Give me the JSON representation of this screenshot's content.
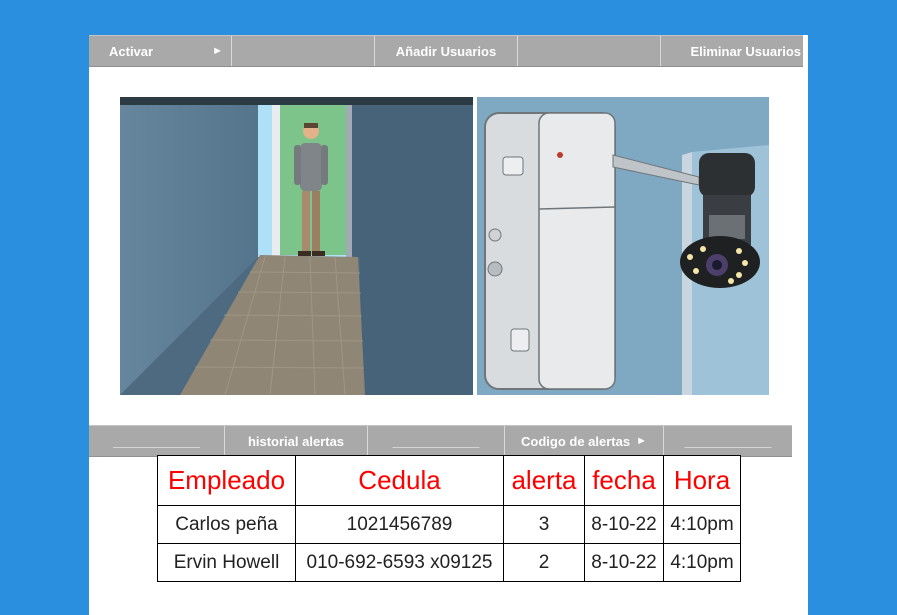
{
  "top_nav": {
    "items": [
      {
        "label": "Activar",
        "arrow": "►"
      },
      {
        "label": ""
      },
      {
        "label": "Añadir Usuarios"
      },
      {
        "label": ""
      },
      {
        "label": "Eliminar Usuarios"
      }
    ]
  },
  "bottom_nav": {
    "items": [
      {
        "label": "____________"
      },
      {
        "label": "historial alertas"
      },
      {
        "label": "____________"
      },
      {
        "label": "Codigo de alertas",
        "arrow": "►"
      },
      {
        "label": "____________"
      }
    ]
  },
  "images": {
    "left": "hallway-illustration",
    "right": "security-camera-illustration"
  },
  "table": {
    "headers": [
      "Empleado",
      "Cedula",
      "alerta",
      "fecha",
      "Hora"
    ],
    "rows": [
      [
        "Carlos peña",
        "1021456789",
        "3",
        "8-10-22",
        "4:10pm"
      ],
      [
        "Ervin Howell",
        "010-692-6593 x09125",
        "2",
        "8-10-22",
        "4:10pm"
      ]
    ]
  },
  "colors": {
    "background": "#2b8fe0",
    "nav": "#a9a9a9",
    "header_text": "#ff0000"
  }
}
